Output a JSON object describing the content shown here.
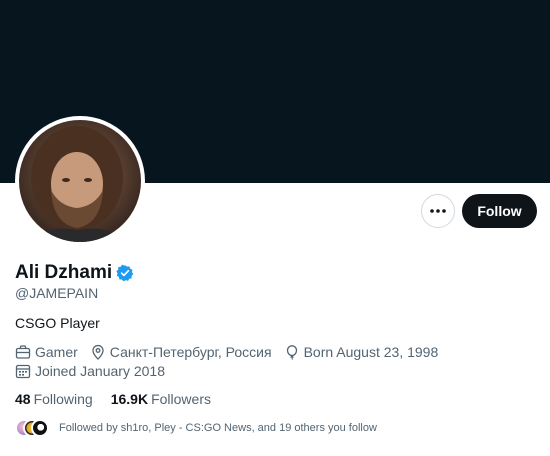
{
  "profile": {
    "name": "Ali Dzhami",
    "handle": "@JAMEPAIN",
    "bio": "CSGO Player",
    "category": "Gamer",
    "location": "Санкт-Петербург, Россия",
    "birthday": "Born August 23, 1998",
    "joined": "Joined January 2018",
    "verified": true
  },
  "actions": {
    "follow_label": "Follow",
    "more_icon": "more-horizontal-icon"
  },
  "stats": {
    "following_count": "48",
    "following_label": "Following",
    "followers_count": "16.9K",
    "followers_label": "Followers"
  },
  "followed_by": {
    "text": "Followed by sh1ro, Pley - CS:GO News, and 19 others you follow"
  },
  "colors": {
    "banner": "#07151e",
    "verified": "#1d9bf0",
    "follow_button": "#0f1419",
    "secondary_text": "#536471"
  }
}
